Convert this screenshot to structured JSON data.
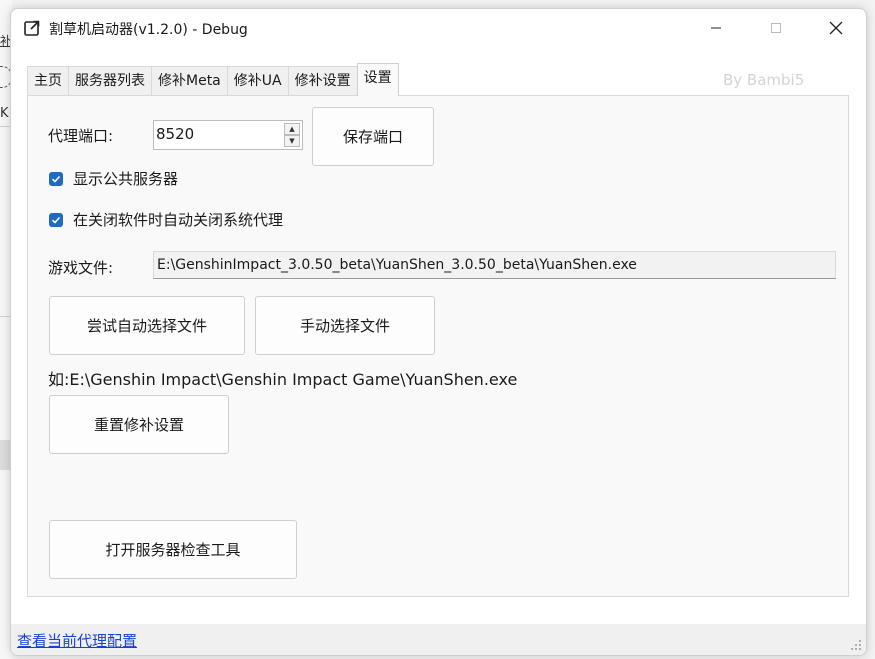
{
  "window": {
    "title": "割草机启动器(v1.2.0) - Debug",
    "watermark": "By Bambi5"
  },
  "background": {
    "frag1": "补",
    "frag3": "K"
  },
  "tabs": [
    {
      "label": "主页",
      "active": false
    },
    {
      "label": "服务器列表",
      "active": false
    },
    {
      "label": "修补Meta",
      "active": false
    },
    {
      "label": "修补UA",
      "active": false
    },
    {
      "label": "修补设置",
      "active": false
    },
    {
      "label": "设置",
      "active": true
    }
  ],
  "settings": {
    "proxy_port_label": "代理端口:",
    "proxy_port_value": "8520",
    "save_port_button": "保存端口",
    "show_public_servers_label": "显示公共服务器",
    "show_public_servers_checked": true,
    "auto_close_proxy_label": "在关闭软件时自动关闭系统代理",
    "auto_close_proxy_checked": true,
    "game_file_label": "游戏文件:",
    "game_file_path": "E:\\GenshinImpact_3.0.50_beta\\YuanShen_3.0.50_beta\\YuanShen.exe",
    "auto_select_button": "尝试自动选择文件",
    "manual_select_button": "手动选择文件",
    "example_text": "如:E:\\Genshin Impact\\Genshin Impact Game\\YuanShen.exe",
    "reset_patch_button": "重置修补设置",
    "open_checker_button": "打开服务器检查工具"
  },
  "status": {
    "link": "查看当前代理配置"
  },
  "colors": {
    "accent": "#1f6bc4",
    "link": "#1a3fd6",
    "watermark": "#d4d4d4"
  },
  "icons": {
    "app": "external-link-icon",
    "minimize": "minimize-icon",
    "maximize": "maximize-icon",
    "close": "close-icon",
    "grip": "resize-grip-icon"
  }
}
